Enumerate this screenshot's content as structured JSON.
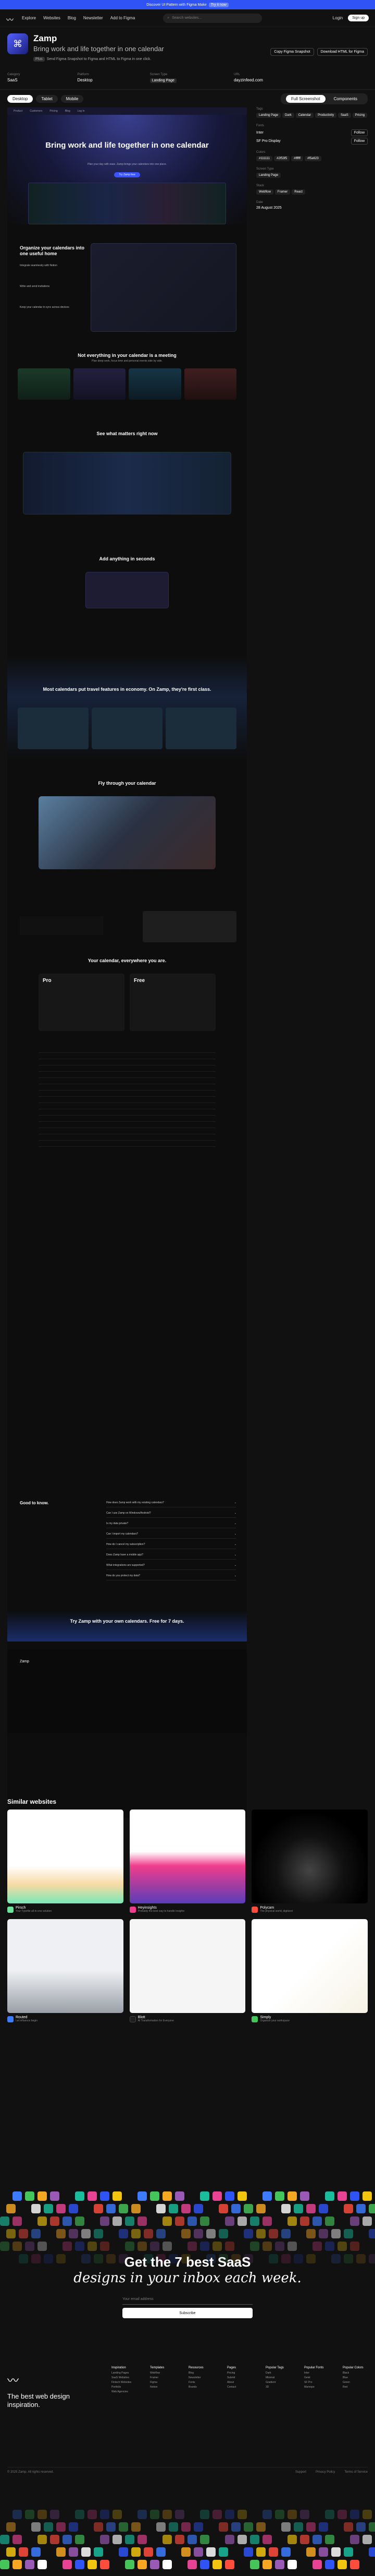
{
  "banner": {
    "text": "Discover UI Pattern with Figma Make",
    "pill": "Try it now"
  },
  "nav": {
    "items": [
      "Explore",
      "Websites",
      "Blog",
      "Newsletter",
      "Add to Figma"
    ],
    "search_placeholder": "Search websites...",
    "login": "Login",
    "signup": "Sign up"
  },
  "app": {
    "name": "Zamp",
    "tagline": "Bring work and life together in one calendar",
    "plus_badge": "Plus",
    "plus_note": "Send Figma Snapshot to Figma and HTML to Figma in one click.",
    "copy_button": "Copy Figma Snapshot",
    "download_button": "Download HTML for Figma"
  },
  "meta": {
    "category_label": "Category",
    "category_value": "SaaS",
    "platform_label": "Platform",
    "platform_value": "Desktop",
    "page_label": "Screen Type",
    "page_value": "Landing Page",
    "url_label": "URL",
    "url_value": "dayzinfeed.com"
  },
  "tabs": {
    "left": [
      "Desktop",
      "Tablet",
      "Mobile"
    ],
    "active_left": "Desktop",
    "right": [
      "Full Screenshot",
      "Components"
    ],
    "active_right": "Full Screenshot"
  },
  "site": {
    "nav": [
      "Product",
      "Customers",
      "Pricing",
      "Blog",
      "Log in"
    ],
    "hero_title": "Bring work and life together in one calendar",
    "hero_sub": "Plan your day with ease. Zamp brings your calendars into one place.",
    "hero_cta": "Try Zamp free",
    "s2_title": "Organize your calendars into one useful home",
    "s2_points": [
      "Integrate seamlessly with Notion",
      "Write and send invitations",
      "Keep your calendar in sync across devices"
    ],
    "s3_title": "Not everything in your calendar is a meeting",
    "s3_sub": "Plan deep work, focus time and personal events side by side.",
    "s4_title": "See what matters right now",
    "s5_title": "Add anything in seconds",
    "s6_title": "Most calendars put travel features in economy. On Zamp, they're first class.",
    "s7_title": "Fly through your calendar",
    "s8_title": "Your calendar, everywhere you are.",
    "plan_free": "Free",
    "plan_pro": "Pro",
    "faq_title": "Good to know.",
    "faq": [
      "How does Zamp work with my existing calendars?",
      "Can I use Zamp on Windows/Android?",
      "Is my data private?",
      "Can I import my calendars?",
      "How do I cancel my subscription?",
      "Does Zamp have a mobile app?",
      "What integrations are supported?",
      "How do you protect my data?"
    ],
    "cta_title": "Try Zamp with your own calendars. Free for 7 days.",
    "footer_brand": "Zamp"
  },
  "sidebar": {
    "tags_label": "Tags",
    "tags": [
      "Landing Page",
      "Dark",
      "Calendar",
      "Productivity",
      "SaaS",
      "Pricing"
    ],
    "fonts_label": "Fonts",
    "fonts": [
      "Inter",
      "SF Pro Display"
    ],
    "colors_label": "Colors",
    "colors": [
      "#111111",
      "#2f53f5",
      "#ffffff",
      "#f5a623"
    ],
    "screen_label": "Screen Type",
    "screen_value": "Landing Page",
    "stack_label": "Stack",
    "stack": [
      "Webflow",
      "Framer",
      "React"
    ],
    "date_label": "Date",
    "date_value": "28 August 2025",
    "follow": "Follow"
  },
  "similar": {
    "title": "Similar websites",
    "items": [
      {
        "name": "Pirsch",
        "desc": "Your Typefile all-in-one solution",
        "color": "#6ce39b"
      },
      {
        "name": "Heyinsights",
        "desc": "Probably the best way to handle insights",
        "color": "#f03d8b"
      },
      {
        "name": "Polycam",
        "desc": "The physical world, digitized",
        "color": "#ff4d3d"
      },
      {
        "name": "Routed",
        "desc": "Let influence begin",
        "color": "#3d7bff"
      },
      {
        "name": "Blott",
        "desc": "AI Transformation for Everyone",
        "color": "#1e1e1e"
      },
      {
        "name": "Simply",
        "desc": "Organize your workspace",
        "color": "#45c45a"
      }
    ]
  },
  "newsletter": {
    "line1": "Get the 7 best SaaS",
    "line2": "designs in your inbox each week.",
    "placeholder": "Your email address",
    "subscribe": "Subscribe"
  },
  "footer": {
    "tagline": "The best web design inspiration.",
    "cols": [
      {
        "head": "Inspiration",
        "items": [
          "Landing Pages",
          "SaaS Websites",
          "Fintech Websites",
          "Portfolio",
          "Web Agencies"
        ]
      },
      {
        "head": "Templates",
        "items": [
          "Webflow",
          "Framer",
          "Figma",
          "Notion"
        ]
      },
      {
        "head": "Resources",
        "items": [
          "Blog",
          "Newsletter",
          "Fonts",
          "Brands"
        ]
      },
      {
        "head": "Pages",
        "items": [
          "Pricing",
          "Submit",
          "About",
          "Contact"
        ]
      },
      {
        "head": "Popular Tags",
        "items": [
          "Dark",
          "Minimal",
          "Gradient",
          "3D"
        ]
      },
      {
        "head": "Popular Fonts",
        "items": [
          "Inter",
          "Geist",
          "SF Pro",
          "Manrope"
        ]
      },
      {
        "head": "Popular Colors",
        "items": [
          "Black",
          "Blue",
          "Green",
          "Red"
        ]
      }
    ],
    "copyright": "© 2025 Zamp. All rights reserved.",
    "links": [
      "Support",
      "Privacy Policy",
      "Terms of Service"
    ]
  }
}
